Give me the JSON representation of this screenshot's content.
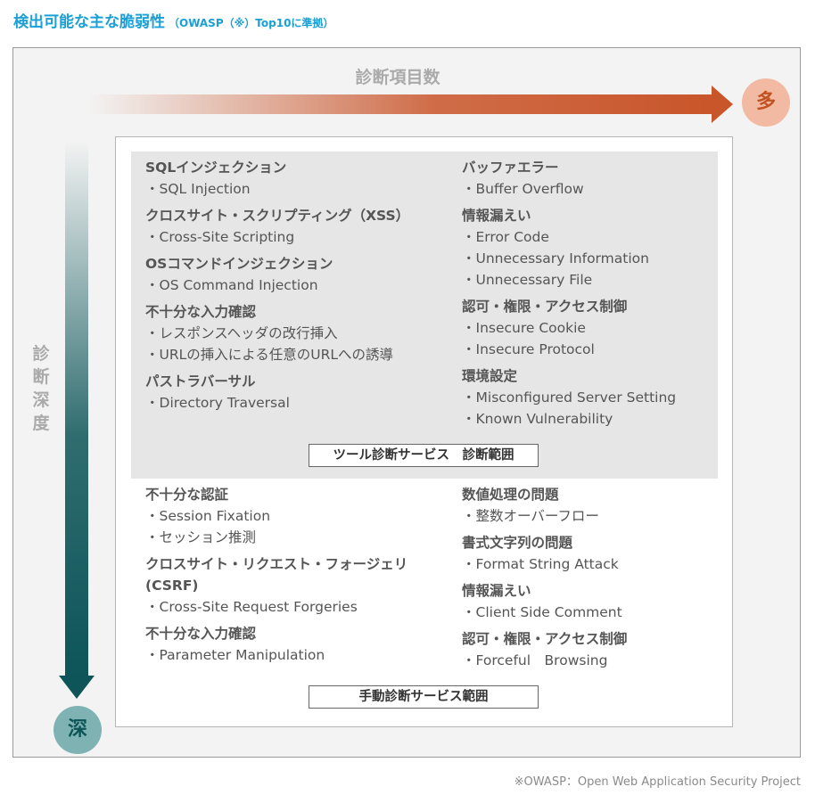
{
  "title": {
    "main": "検出可能な主な脆弱性",
    "sub": "（OWASP（※）Top10に準拠）"
  },
  "axes": {
    "horizontal_label": "診断項目数",
    "horizontal_end": "多",
    "vertical_label": [
      "診",
      "断",
      "深",
      "度"
    ],
    "vertical_end": "深"
  },
  "colors": {
    "title": "#1aa0d6",
    "arrow_h": "#c9552a",
    "arrow_v": "#0d5558"
  },
  "tool_section": {
    "left": [
      {
        "heading": "SQLインジェクション",
        "items": [
          "SQL Injection"
        ]
      },
      {
        "heading": "クロスサイト・スクリプティング（XSS）",
        "items": [
          "Cross-Site Scripting"
        ]
      },
      {
        "heading": "OSコマンドインジェクション",
        "items": [
          "OS Command Injection"
        ]
      },
      {
        "heading": "不十分な入力確認",
        "items": [
          "レスポンスヘッダの改行挿入",
          "URLの挿入による任意のURLへの誘導"
        ]
      },
      {
        "heading": "パストラバーサル",
        "items": [
          "Directory Traversal"
        ]
      }
    ],
    "right": [
      {
        "heading": "バッファエラー",
        "items": [
          "Buffer Overflow"
        ]
      },
      {
        "heading": "情報漏えい",
        "items": [
          "Error Code",
          "Unnecessary Information",
          "Unnecessary File"
        ]
      },
      {
        "heading": "認可・権限・アクセス制御",
        "items": [
          "Insecure Cookie",
          "Insecure Protocol"
        ]
      },
      {
        "heading": "環境設定",
        "items": [
          "Misconfigured Server Setting",
          "Known Vulnerability"
        ]
      }
    ],
    "label": "ツール診断サービス　診断範囲"
  },
  "manual_section": {
    "left": [
      {
        "heading": "不十分な認証",
        "items": [
          "Session Fixation",
          "セッション推測"
        ]
      },
      {
        "heading": "クロスサイト・リクエスト・フォージェリ",
        "heading2": "(CSRF)",
        "items": [
          "Cross-Site Request Forgeries"
        ]
      },
      {
        "heading": "不十分な入力確認",
        "items": [
          "Parameter Manipulation"
        ]
      }
    ],
    "right": [
      {
        "heading": "数値処理の問題",
        "items": [
          "整数オーバーフロー"
        ]
      },
      {
        "heading": "書式文字列の問題",
        "items": [
          "Format String Attack"
        ]
      },
      {
        "heading": "情報漏えい",
        "items": [
          "Client Side Comment"
        ]
      },
      {
        "heading": "認可・権限・アクセス制御",
        "items": [
          "Forceful　Browsing"
        ]
      }
    ],
    "label": "手動診断サービス範囲"
  },
  "footnote": "※OWASP：Open Web Application Security Project"
}
